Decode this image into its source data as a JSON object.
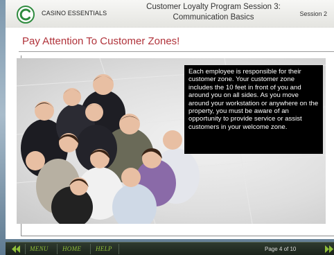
{
  "header": {
    "brand": "CASINO ESSENTIALS",
    "course_title_line1": "Customer Loyalty Program Session 3:",
    "course_title_line2": "Communication Basics",
    "session": "Session 2"
  },
  "slide": {
    "title": "Pay Attention To Customer Zones!",
    "callout": "Each employee is responsible for their customer zone.  Your customer zone includes the 10 feet in front of you and around you on all sides.  As you move around your workstation or anywhere on the property, you must be aware of an opportunity to provide service or assist customers in your welcome zone.",
    "photo_subject": "group of smiling business people looking up"
  },
  "nav": {
    "menu": "MENU",
    "home": "HOME",
    "help": "HELP",
    "page": "Page 4 of 10"
  },
  "colors": {
    "title_red": "#b0323a",
    "nav_green": "#8fbf3a",
    "logo_green": "#2e8b3e"
  },
  "icons": {
    "back": "double-left-arrow-icon",
    "next": "double-right-arrow-icon"
  }
}
